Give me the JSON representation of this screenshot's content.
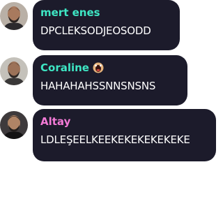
{
  "messages": [
    {
      "author": "mert enes",
      "author_color": "#3ee6c4",
      "text": "DPCLEKSODJEOSODD"
    },
    {
      "author": "Coraline",
      "author_color": "#3ee6c4",
      "badge_icon": "screaming-face-icon",
      "text": "HAHAHAHSSNNSNSNS"
    },
    {
      "author": "Altay",
      "author_color": "#f27ad6",
      "text": "LDLEŞEELKEEKEKEKEKEKEKE"
    }
  ],
  "colors": {
    "bubble_background": "#1c1b2b",
    "message_text": "#ffffff"
  }
}
